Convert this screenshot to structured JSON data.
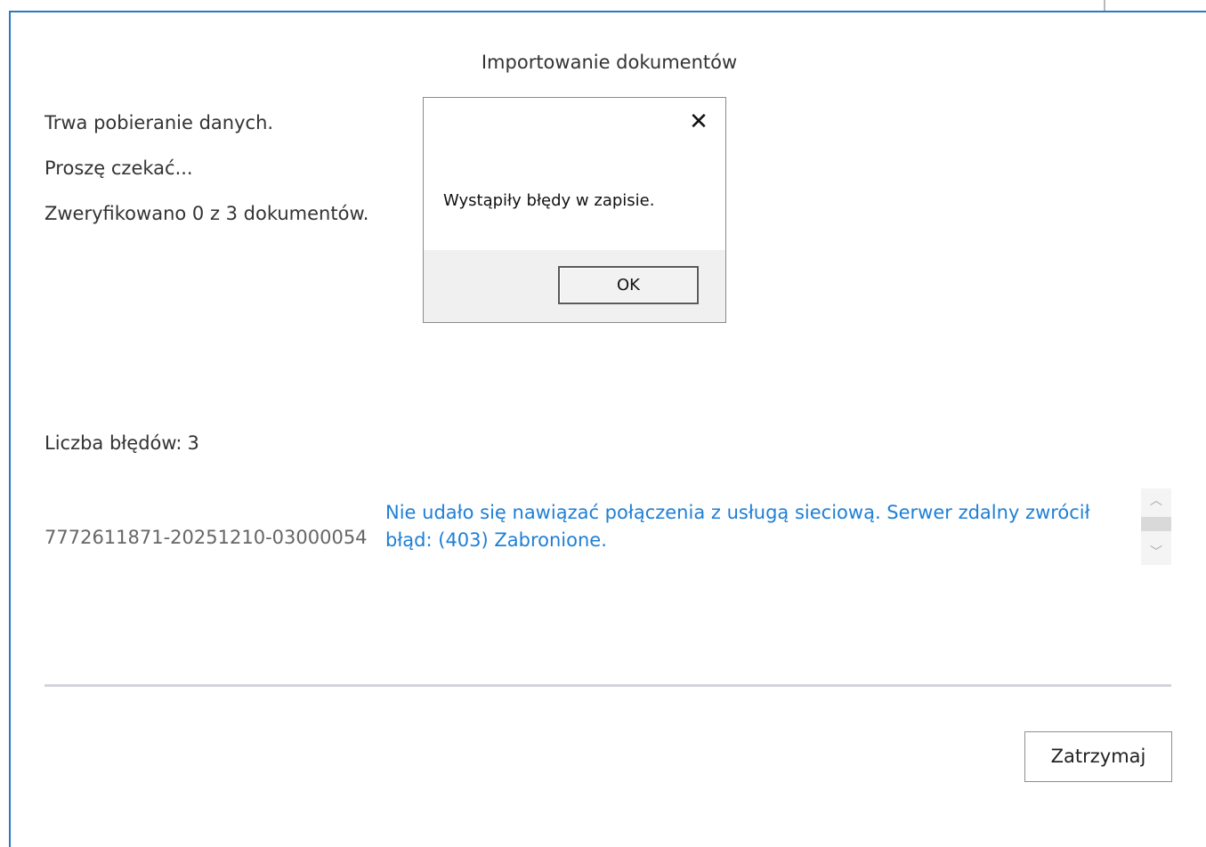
{
  "dialog": {
    "title": "Importowanie dokumentów",
    "status_lines": [
      "Trwa pobieranie danych.",
      "Proszę czekać...",
      "Zweryfikowano 0 z 3 dokumentów."
    ],
    "errors_label": "Liczba błędów:",
    "errors_count": "3",
    "error_entry": {
      "document_id": "7772611871-20251210-03000054",
      "message": "Nie udało się nawiązać połączenia z usługą sieciową. Serwer zdalny zwrócił błąd: (403) Zabronione."
    },
    "stop_button_label": "Zatrzymaj",
    "accent_color": "#2b79c2",
    "error_text_color": "#1e7fd6"
  },
  "message_box": {
    "close_glyph": "✕",
    "text": "Wystąpiły błędy w zapisie.",
    "ok_label": "OK"
  },
  "icons": {
    "close": "close-icon",
    "scroll_up": "chevron-up-icon",
    "scroll_down": "chevron-down-icon"
  }
}
